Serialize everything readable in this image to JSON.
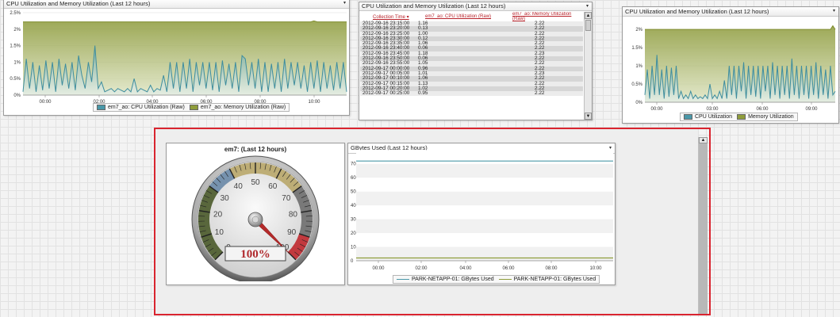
{
  "panel1": {
    "title": "CPU Utilization and Memory Utilization (Last 12 hours)",
    "legend": [
      {
        "label": "em7_ao: CPU Utilization (Raw)",
        "color": "#4a98a9"
      },
      {
        "label": "em7_ao: Memory Utilization (Raw)",
        "color": "#8f9d3b"
      }
    ]
  },
  "panel2": {
    "title": "CPU Utilization and Memory Utilization (Last 12 hours)",
    "columns": [
      "Collection Time ▾",
      "em7_ao: CPU Utilization (Raw)",
      "em7_ao: Memory Utilization (Raw)"
    ],
    "rows": [
      [
        "2012-09-16 23:15:00",
        "1.16",
        "2.22"
      ],
      [
        "2012-09-16 23:20:00",
        "0.13",
        "2.22"
      ],
      [
        "2012-09-16 23:25:00",
        "1.00",
        "2.22"
      ],
      [
        "2012-09-16 23:30:00",
        "0.12",
        "2.22"
      ],
      [
        "2012-09-16 23:35:00",
        "1.06",
        "2.22"
      ],
      [
        "2012-09-16 23:40:00",
        "0.06",
        "2.22"
      ],
      [
        "2012-09-16 23:45:00",
        "1.18",
        "2.23"
      ],
      [
        "2012-09-16 23:50:00",
        "0.06",
        "2.22"
      ],
      [
        "2012-09-16 23:55:00",
        "1.05",
        "2.22"
      ],
      [
        "2012-09-17 00:00:00",
        "0.96",
        "2.22"
      ],
      [
        "2012-09-17 00:05:00",
        "1.01",
        "2.23"
      ],
      [
        "2012-09-17 00:10:00",
        "1.06",
        "2.22"
      ],
      [
        "2012-09-17 00:15:00",
        "1.13",
        "2.22"
      ],
      [
        "2012-09-17 00:20:00",
        "1.02",
        "2.22"
      ],
      [
        "2012-09-17 00:25:00",
        "0.95",
        "2.22"
      ]
    ]
  },
  "panel3": {
    "title": "CPU Utilization and Memory Utilization (Last 12 hours)",
    "legend": [
      {
        "label": "CPU Utilization",
        "color": "#4a98a9"
      },
      {
        "label": "Memory Utilization",
        "color": "#8f9d3b"
      }
    ]
  },
  "gauge": {
    "title": "em7: (Last 12 hours)",
    "readout": "100%",
    "value": 100,
    "ticks": [
      "0",
      "10",
      "20",
      "30",
      "40",
      "50",
      "60",
      "70",
      "80",
      "90",
      "100"
    ]
  },
  "gbytes": {
    "title": "GBytes Used (Last 12 hours)",
    "legend": [
      {
        "label": "PARK-NETAPP-01: GBytes Used",
        "color": "#4a98a9"
      },
      {
        "label": "PARK-NETAPP-01: GBytes Used",
        "color": "#8f9d3b"
      }
    ]
  },
  "chart_data": [
    {
      "type": "area",
      "title": "CPU Utilization and Memory Utilization (Last 12 hours)",
      "x_ticks": [
        "00:00",
        "02:00",
        "04:00",
        "06:00",
        "08:00",
        "10:00"
      ],
      "y_ticks": [
        "0%",
        "0.5%",
        "1%",
        "1.5%",
        "2%",
        "2.5%"
      ],
      "ylim": [
        0,
        2.5
      ],
      "series": [
        {
          "name": "em7_ao: Memory Utilization (Raw)",
          "color": "#8f9d3b",
          "values": [
            2.22,
            2.22,
            2.22,
            2.22,
            2.22,
            2.22,
            2.22,
            2.22,
            2.22,
            2.22,
            2.22,
            2.22,
            2.22,
            2.22,
            2.22,
            2.22,
            2.22,
            2.22,
            2.22,
            2.22,
            2.22,
            2.22,
            2.22,
            2.22,
            2.22,
            2.22,
            2.22,
            2.22,
            2.22,
            2.22,
            2.22,
            2.22,
            2.22,
            2.22,
            2.22,
            2.22,
            2.22,
            2.22,
            2.22,
            2.22,
            2.22,
            2.22,
            2.22,
            2.22,
            2.22,
            2.22,
            2.22,
            2.22,
            2.22,
            2.22,
            2.22,
            2.22,
            2.22,
            2.22,
            2.22,
            2.22,
            2.22,
            2.22,
            2.22,
            2.22,
            2.22,
            2.22,
            2.22,
            2.22,
            2.22,
            2.22,
            2.22,
            2.22,
            2.22,
            2.22,
            2.22,
            2.22,
            2.22,
            2.22,
            2.22,
            2.22,
            2.22,
            2.22,
            2.22,
            2.22,
            2.22,
            2.22,
            2.22,
            2.22,
            2.22,
            2.22,
            2.22,
            2.22,
            2.22,
            2.25,
            2.22,
            2.22,
            2.22,
            2.22,
            2.22,
            2.22,
            2.22,
            2.22,
            2.22,
            2.22
          ]
        },
        {
          "name": "em7_ao: CPU Utilization (Raw)",
          "color": "#4a98a9",
          "values": [
            0.1,
            1.1,
            0.2,
            1.0,
            0.1,
            0.9,
            0.15,
            1.05,
            0.2,
            1.0,
            0.1,
            1.1,
            0.3,
            0.95,
            0.2,
            1.0,
            0.15,
            1.2,
            0.6,
            0.2,
            1.0,
            0.4,
            1.5,
            0.2,
            0.4,
            0.1,
            0.15,
            0.2,
            0.1,
            0.2,
            0.15,
            0.1,
            0.2,
            0.1,
            0.5,
            0.1,
            0.2,
            0.15,
            0.1,
            0.3,
            0.1,
            0.2,
            0.15,
            0.6,
            0.1,
            1.0,
            0.2,
            1.0,
            0.1,
            1.0,
            0.2,
            1.1,
            0.1,
            1.0,
            0.3,
            1.0,
            0.2,
            1.0,
            0.15,
            1.0,
            0.1,
            1.05,
            0.3,
            0.95,
            0.2,
            1.0,
            0.1,
            1.2,
            1.1,
            0.3,
            1.0,
            0.2,
            1.1,
            0.1,
            1.0,
            0.1,
            0.95,
            0.2,
            1.0,
            0.1,
            1.1,
            0.2,
            1.0,
            0.3,
            1.0,
            0.2,
            0.9,
            0.1,
            1.0,
            0.2,
            1.05,
            0.1,
            1.0,
            0.2,
            0.9,
            0.15,
            1.0,
            0.2,
            1.0,
            0.1
          ]
        }
      ]
    },
    {
      "type": "area",
      "title": "CPU Utilization and Memory Utilization (Last 12 hours)",
      "x_ticks": [
        "03:00",
        "06:00",
        "09:00"
      ],
      "x0_tick": "00:00",
      "y_ticks": [
        "0%",
        "0.5%",
        "1%",
        "1.5%",
        "2%"
      ],
      "ylim": [
        0,
        2.2
      ],
      "series": [
        {
          "name": "Memory Utilization",
          "color": "#8f9d3b",
          "values": [
            2.0,
            2.0,
            2.0,
            2.0,
            2.0,
            2.0,
            2.0,
            2.0,
            2.0,
            2.0,
            2.0,
            2.0,
            2.0,
            2.0,
            2.0,
            2.0,
            2.0,
            2.0,
            2.0,
            2.0,
            2.0,
            2.0,
            2.0,
            2.0,
            2.0,
            2.0,
            2.0,
            2.0,
            2.0,
            2.0,
            2.0,
            2.0,
            2.0,
            2.0,
            2.0,
            2.0,
            2.0,
            2.0,
            2.0,
            2.0,
            2.0,
            2.0,
            2.0,
            2.0,
            2.0,
            2.0,
            2.0,
            2.0,
            2.0,
            2.0,
            2.0,
            2.0,
            2.0,
            2.0,
            2.0,
            2.0,
            2.0,
            2.0,
            2.0,
            2.0,
            2.0,
            2.0,
            2.0,
            2.0,
            2.0,
            2.0,
            2.0,
            2.0,
            2.0,
            2.0,
            2.0,
            2.0,
            2.0,
            2.0,
            2.0,
            2.0,
            2.0,
            2.0,
            2.1,
            2.0
          ]
        },
        {
          "name": "CPU Utilization",
          "color": "#4a98a9",
          "values": [
            0.2,
            0.9,
            0.1,
            1.0,
            0.2,
            1.3,
            0.2,
            0.9,
            0.1,
            1.0,
            0.15,
            0.95,
            0.2,
            1.0,
            0.1,
            0.3,
            0.1,
            0.2,
            0.1,
            0.3,
            0.1,
            0.2,
            0.1,
            0.15,
            0.1,
            0.2,
            0.1,
            0.5,
            0.1,
            0.2,
            0.1,
            0.3,
            0.1,
            0.6,
            0.1,
            1.0,
            0.2,
            1.0,
            0.1,
            1.0,
            0.3,
            1.1,
            0.1,
            1.0,
            0.2,
            1.0,
            0.15,
            1.0,
            0.1,
            1.0,
            0.3,
            1.0,
            0.1,
            1.1,
            0.2,
            1.0,
            0.1,
            1.0,
            0.2,
            1.0,
            0.1,
            1.2,
            0.2,
            1.0,
            0.1,
            1.0,
            0.2,
            1.0,
            0.1,
            1.0,
            0.2,
            1.1,
            0.1,
            1.0,
            0.2,
            0.9,
            0.1,
            1.0,
            0.2,
            0.3
          ]
        }
      ]
    },
    {
      "type": "line",
      "title": "GBytes Used (Last 12 hours)",
      "x_ticks": [
        "00:00",
        "02:00",
        "04:00",
        "06:00",
        "08:00",
        "10:00"
      ],
      "y_ticks": [
        "0",
        "10",
        "20",
        "30",
        "40",
        "50",
        "60",
        "70"
      ],
      "ylim": [
        0,
        75
      ],
      "series": [
        {
          "name": "PARK-NETAPP-01: GBytes Used",
          "color": "#4a98a9",
          "values": [
            72,
            72,
            72,
            72,
            72,
            72,
            72,
            72,
            72,
            72,
            72,
            72
          ]
        },
        {
          "name": "PARK-NETAPP-01: GBytes Used",
          "color": "#8f9d3b",
          "values": [
            2,
            2,
            2,
            2,
            2,
            2,
            2,
            2,
            2,
            2,
            2,
            2
          ]
        }
      ]
    }
  ]
}
